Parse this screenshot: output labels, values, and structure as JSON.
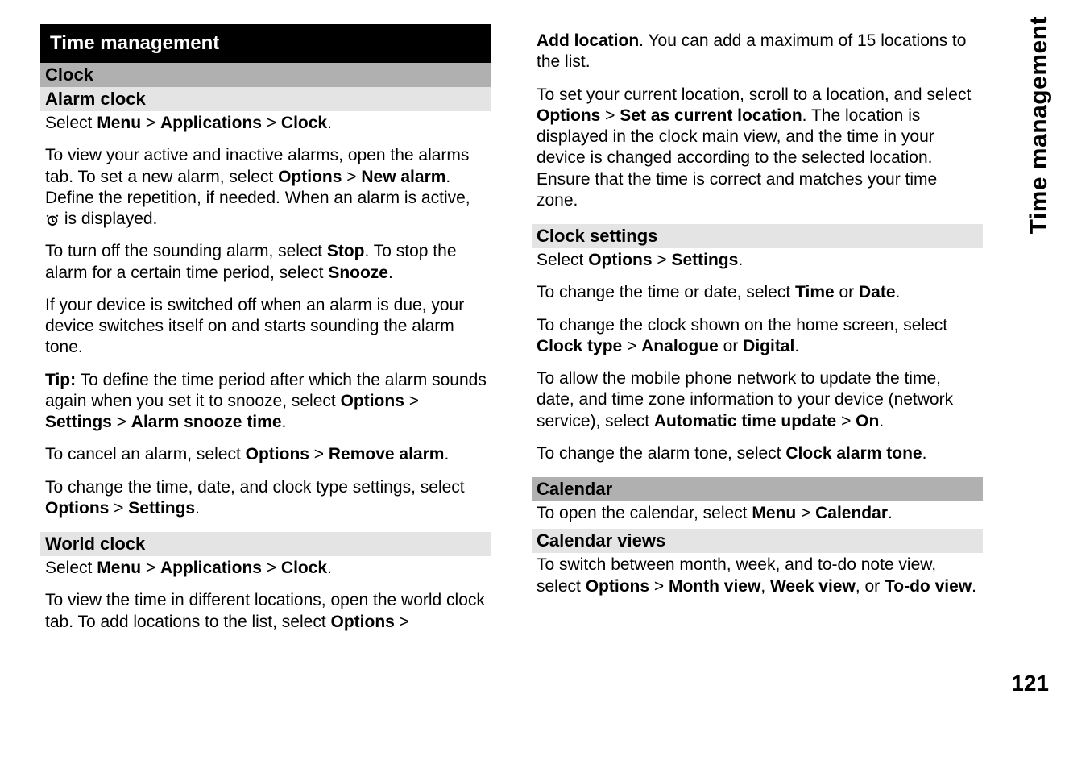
{
  "chapterTitle": "Time management",
  "sideTab": "Time management",
  "pageNumber": "121",
  "left": {
    "clock": {
      "heading": "Clock",
      "alarmHeading": "Alarm clock",
      "p1_a": "Select ",
      "p1_menu": "Menu",
      "p1_b": " > ",
      "p1_apps": "Applications",
      "p1_c": " > ",
      "p1_clock": "Clock",
      "p1_d": ".",
      "p2_a": "To view your active and inactive alarms, open the alarms tab. To set a new alarm, select ",
      "p2_opts": "Options",
      "p2_b": " > ",
      "p2_new": "New alarm",
      "p2_c": ". Define the repetition, if needed. When an alarm is active, ",
      "p2_d": " is displayed.",
      "p3_a": "To turn off the sounding alarm, select ",
      "p3_stop": "Stop",
      "p3_b": ". To stop the alarm for a certain time period, select ",
      "p3_snooze": "Snooze",
      "p3_c": ".",
      "p4": "If your device is switched off when an alarm is due, your device switches itself on and starts sounding the alarm tone.",
      "p5_tip": "Tip:",
      "p5_a": " To define the time period after which the alarm sounds again when you set it to snooze, select ",
      "p5_opts": "Options",
      "p5_b": " > ",
      "p5_set": "Settings",
      "p5_c": " > ",
      "p5_ast": "Alarm snooze time",
      "p5_d": ".",
      "p6_a": "To cancel an alarm, select ",
      "p6_opts": "Options",
      "p6_b": " > ",
      "p6_rem": "Remove alarm",
      "p6_c": ".",
      "p7_a": "To change the time, date, and clock type settings, select ",
      "p7_opts": "Options",
      "p7_b": " > ",
      "p7_set": "Settings",
      "p7_c": "."
    },
    "world": {
      "heading": "World clock",
      "p1_a": "Select ",
      "p1_menu": "Menu",
      "p1_b": " > ",
      "p1_apps": "Applications",
      "p1_c": " > ",
      "p1_clock": "Clock",
      "p1_d": ".",
      "p2_a": "To view the time in different locations, open the world clock tab. To add locations to the list, select ",
      "p2_opts": "Options",
      "p2_b": " > "
    }
  },
  "right": {
    "addloc": {
      "p1_add": "Add location",
      "p1_a": ". You can add a maximum of 15 locations to the list.",
      "p2_a": "To set your current location, scroll to a location, and select ",
      "p2_opts": "Options",
      "p2_b": " > ",
      "p2_set": "Set as current location",
      "p2_c": ". The location is displayed in the clock main view, and the time in your device is changed according to the selected location. Ensure that the time is correct and matches your time zone."
    },
    "settings": {
      "heading": "Clock settings",
      "p1_a": "Select ",
      "p1_opts": "Options",
      "p1_b": " > ",
      "p1_set": "Settings",
      "p1_c": ".",
      "p2_a": "To change the time or date, select ",
      "p2_time": "Time",
      "p2_b": " or ",
      "p2_date": "Date",
      "p2_c": ".",
      "p3_a": "To change the clock shown on the home screen, select ",
      "p3_ct": "Clock type",
      "p3_b": " > ",
      "p3_ana": "Analogue",
      "p3_c": " or ",
      "p3_dig": "Digital",
      "p3_d": ".",
      "p4_a": "To allow the mobile phone network to update the time, date, and time zone information to your device (network service), select ",
      "p4_atu": "Automatic time update",
      "p4_b": " > ",
      "p4_on": "On",
      "p4_c": ".",
      "p5_a": "To change the alarm tone, select ",
      "p5_cat": "Clock alarm tone",
      "p5_b": "."
    },
    "calendar": {
      "heading": "Calendar",
      "p1_a": "To open the calendar, select ",
      "p1_menu": "Menu",
      "p1_b": " > ",
      "p1_cal": "Calendar",
      "p1_c": ".",
      "viewsHeading": "Calendar views",
      "p2_a": "To switch between month, week, and to-do note view, select ",
      "p2_opts": "Options",
      "p2_b": " > ",
      "p2_mv": "Month view",
      "p2_c": ", ",
      "p2_wv": "Week view",
      "p2_d": ", or ",
      "p2_tv": "To-do view",
      "p2_e": "."
    }
  }
}
